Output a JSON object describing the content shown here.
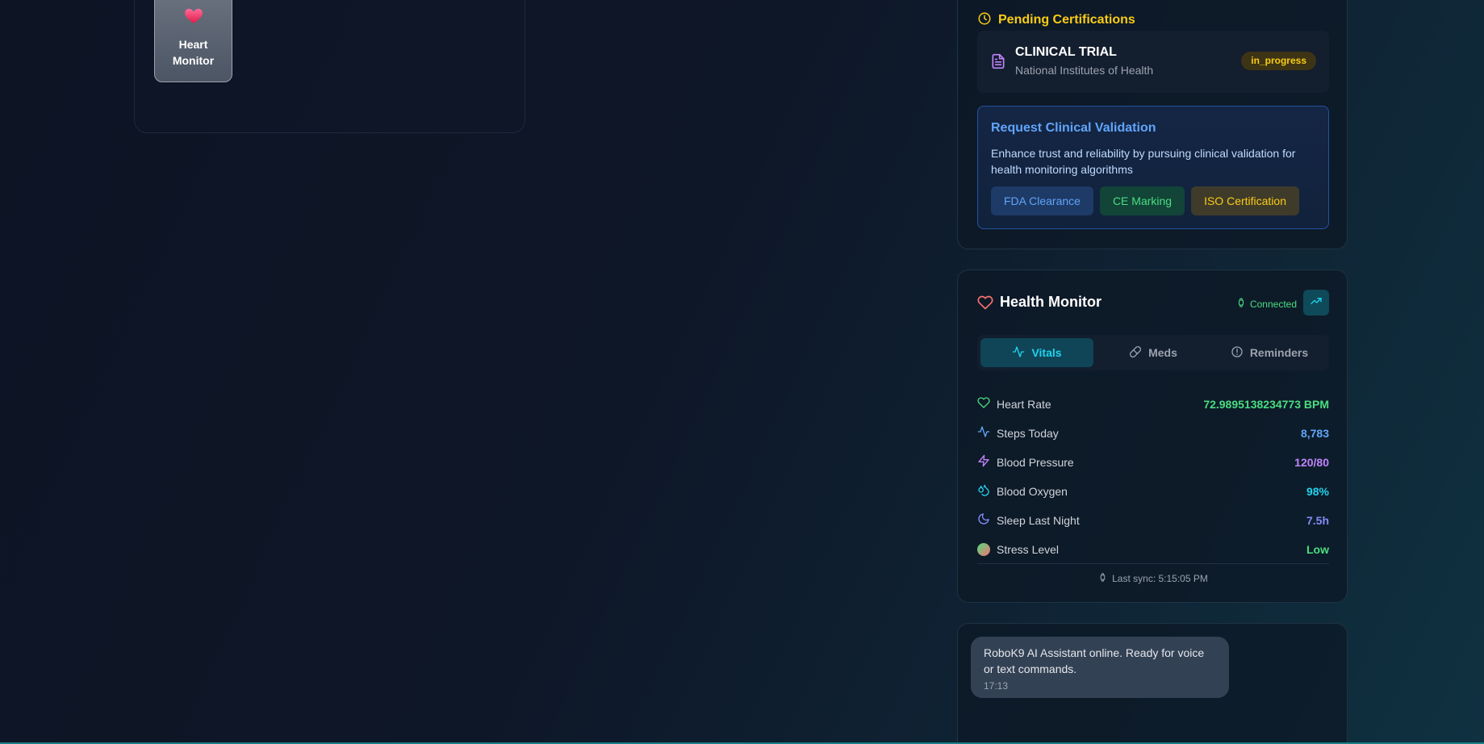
{
  "left_panel": {
    "app_tile": {
      "label": "Heart Monitor",
      "icon": "heart-emoji-icon"
    }
  },
  "certifications": {
    "title": "Pending Certifications",
    "title_icon": "clock-icon",
    "item": {
      "name": "CLINICAL TRIAL",
      "org": "National Institutes of Health",
      "status": "in_progress",
      "icon": "document-icon"
    },
    "validation": {
      "title": "Request Clinical Validation",
      "description": "Enhance trust and reliability by pursuing clinical validation for health monitoring algorithms",
      "buttons": [
        "FDA Clearance",
        "CE Marking",
        "ISO Certification"
      ]
    }
  },
  "health_monitor": {
    "title": "Health Monitor",
    "status": "Connected",
    "tabs": [
      {
        "label": "Vitals",
        "icon": "activity-icon",
        "active": true
      },
      {
        "label": "Meds",
        "icon": "pill-icon",
        "active": false
      },
      {
        "label": "Reminders",
        "icon": "alert-circle-icon",
        "active": false
      }
    ],
    "vitals": [
      {
        "label": "Heart Rate",
        "value": "72.9895138234773 BPM",
        "icon": "heart-icon",
        "color": "#4ade80"
      },
      {
        "label": "Steps Today",
        "value": "8,783",
        "icon": "activity-icon",
        "color": "#60a5fa"
      },
      {
        "label": "Blood Pressure",
        "value": "120/80",
        "icon": "zap-icon",
        "color": "#c084fc"
      },
      {
        "label": "Blood Oxygen",
        "value": "98%",
        "icon": "droplets-icon",
        "color": "#22d3ee"
      },
      {
        "label": "Sleep Last Night",
        "value": "7.5h",
        "icon": "moon-icon",
        "color": "#818cf8"
      },
      {
        "label": "Stress Level",
        "value": "Low",
        "icon": "stress-dot-icon",
        "color": "#4ade80"
      }
    ],
    "last_sync": "Last sync: 5:15:05 PM"
  },
  "chat": {
    "message": "RoboK9 AI Assistant online. Ready for voice or text commands.",
    "time": "17:13"
  },
  "colors": {
    "accent_cyan": "#22d3ee",
    "accent_yellow": "#facc15",
    "accent_blue": "#60a5fa",
    "status_green": "#4ade80"
  }
}
